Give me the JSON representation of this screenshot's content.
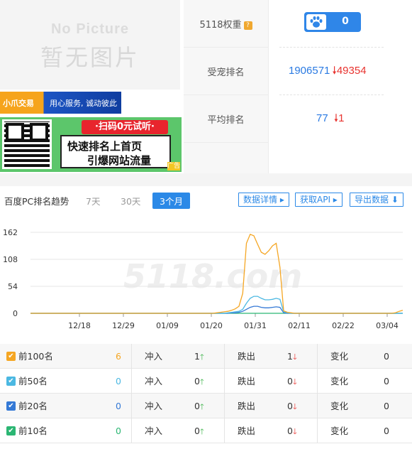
{
  "placeholder": {
    "en": "No Picture",
    "cn": "暂无图片"
  },
  "ads": {
    "banner1": {
      "brand": "小爪交易",
      "slogan": "用心服务, 诚动彼此"
    },
    "banner2": {
      "pill": "·扫码0元试听·",
      "line1": "快速排名上首页",
      "line2": "引爆网站流量",
      "corner": "广告"
    }
  },
  "metrics": [
    {
      "label": "5118权重",
      "has_help": true,
      "help_icon": "?",
      "value": "0",
      "icon": "paw-icon"
    },
    {
      "label": "受宠排名",
      "value": "1906571",
      "change": "49354",
      "direction": "down"
    },
    {
      "label": "平均排名",
      "value": "77",
      "change": "1",
      "direction": "down"
    }
  ],
  "chart_panel": {
    "title": "百度PC排名趋势",
    "ranges": [
      "7天",
      "30天",
      "3个月"
    ],
    "active_range": "3个月",
    "buttons": {
      "details": "数据详情 ▸",
      "api": "获取API ▸",
      "export": "导出数据 ⬇"
    },
    "watermark": "5118.com"
  },
  "chart_data": {
    "type": "line",
    "y_ticks": [
      "162",
      "108",
      "54",
      "0"
    ],
    "ylim": [
      0,
      162
    ],
    "x_ticks": [
      "12/18",
      "12/29",
      "01/09",
      "01/20",
      "01/31",
      "02/11",
      "02/22",
      "03/04"
    ],
    "grid": true,
    "colors": {
      "top100": "#f5a623",
      "top50": "#4bb8e2",
      "top20": "#3479d6",
      "top10": "#2bb673"
    },
    "series": [
      {
        "name": "前100名",
        "color": "#f5a623",
        "values": [
          0,
          0,
          0,
          0,
          0,
          0,
          0,
          0,
          0,
          0,
          0,
          0,
          0,
          0,
          0,
          0,
          0,
          0,
          0,
          0,
          0,
          0,
          0,
          0,
          0,
          0,
          0,
          0,
          0,
          0,
          0,
          0,
          0,
          0,
          0,
          0,
          0,
          0,
          0,
          0,
          0,
          0,
          0,
          0,
          0,
          0,
          0,
          0,
          0,
          0,
          1,
          2,
          3,
          4,
          6,
          9,
          14,
          40,
          140,
          158,
          155,
          138,
          122,
          118,
          125,
          135,
          140,
          92,
          5,
          2,
          1,
          0,
          0,
          0,
          0,
          0,
          0,
          0,
          0,
          0,
          0,
          0,
          0,
          0,
          0,
          0,
          0,
          0,
          0,
          0,
          0,
          0,
          0,
          0,
          0,
          0,
          0,
          0,
          1,
          4,
          6
        ]
      },
      {
        "name": "前50名",
        "color": "#4bb8e2",
        "values": [
          0,
          0,
          0,
          0,
          0,
          0,
          0,
          0,
          0,
          0,
          0,
          0,
          0,
          0,
          0,
          0,
          0,
          0,
          0,
          0,
          0,
          0,
          0,
          0,
          0,
          0,
          0,
          0,
          0,
          0,
          0,
          0,
          0,
          0,
          0,
          0,
          0,
          0,
          0,
          0,
          0,
          0,
          0,
          0,
          0,
          0,
          0,
          0,
          0,
          0,
          0,
          0,
          0,
          1,
          2,
          3,
          4,
          8,
          20,
          30,
          34,
          34,
          30,
          27,
          27,
          28,
          30,
          28,
          3,
          1,
          0,
          0,
          0,
          0,
          0,
          0,
          0,
          0,
          0,
          0,
          0,
          0,
          0,
          0,
          0,
          0,
          0,
          0,
          0,
          0,
          0,
          0,
          0,
          0,
          0,
          0,
          0,
          0,
          0,
          0,
          0
        ]
      },
      {
        "name": "前20名",
        "color": "#3479d6",
        "values": [
          0,
          0,
          0,
          0,
          0,
          0,
          0,
          0,
          0,
          0,
          0,
          0,
          0,
          0,
          0,
          0,
          0,
          0,
          0,
          0,
          0,
          0,
          0,
          0,
          0,
          0,
          0,
          0,
          0,
          0,
          0,
          0,
          0,
          0,
          0,
          0,
          0,
          0,
          0,
          0,
          0,
          0,
          0,
          0,
          0,
          0,
          0,
          0,
          0,
          0,
          0,
          0,
          0,
          0,
          1,
          1,
          2,
          4,
          8,
          12,
          14,
          14,
          12,
          11,
          11,
          12,
          13,
          12,
          1,
          0,
          0,
          0,
          0,
          0,
          0,
          0,
          0,
          0,
          0,
          0,
          0,
          0,
          0,
          0,
          0,
          0,
          0,
          0,
          0,
          0,
          0,
          0,
          0,
          0,
          0,
          0,
          0,
          0,
          0,
          0,
          0
        ]
      },
      {
        "name": "前10名",
        "color": "#2bb673",
        "values": [
          0,
          0,
          0,
          0,
          0,
          0,
          0,
          0,
          0,
          0,
          0,
          0,
          0,
          0,
          0,
          0,
          0,
          0,
          0,
          0,
          0,
          0,
          0,
          0,
          0,
          0,
          0,
          0,
          0,
          0,
          0,
          0,
          0,
          0,
          0,
          0,
          0,
          0,
          0,
          0,
          0,
          0,
          0,
          0,
          0,
          0,
          0,
          0,
          0,
          0,
          0,
          0,
          0,
          0,
          0,
          0,
          0,
          0,
          0,
          0,
          0,
          0,
          0,
          0,
          0,
          0,
          0,
          0,
          0,
          0,
          0,
          0,
          0,
          0,
          0,
          0,
          0,
          0,
          0,
          0,
          0,
          0,
          0,
          0,
          0,
          0,
          0,
          0,
          0,
          0,
          0,
          0,
          0,
          0,
          0,
          0,
          0,
          0,
          0,
          0,
          0
        ]
      }
    ]
  },
  "table": {
    "rows": [
      {
        "label": "前100名",
        "color": "#f5a623",
        "count": "6",
        "in_label": "冲入",
        "in_value": "1",
        "out_label": "跌出",
        "out_value": "1",
        "change_label": "变化",
        "change_value": "0"
      },
      {
        "label": "前50名",
        "color": "#4bb8e2",
        "count": "0",
        "in_label": "冲入",
        "in_value": "0",
        "out_label": "跌出",
        "out_value": "0",
        "change_label": "变化",
        "change_value": "0"
      },
      {
        "label": "前20名",
        "color": "#3479d6",
        "count": "0",
        "in_label": "冲入",
        "in_value": "0",
        "out_label": "跌出",
        "out_value": "0",
        "change_label": "变化",
        "change_value": "0"
      },
      {
        "label": "前10名",
        "color": "#2bb673",
        "count": "0",
        "in_label": "冲入",
        "in_value": "0",
        "out_label": "跌出",
        "out_value": "0",
        "change_label": "变化",
        "change_value": "0"
      }
    ]
  }
}
